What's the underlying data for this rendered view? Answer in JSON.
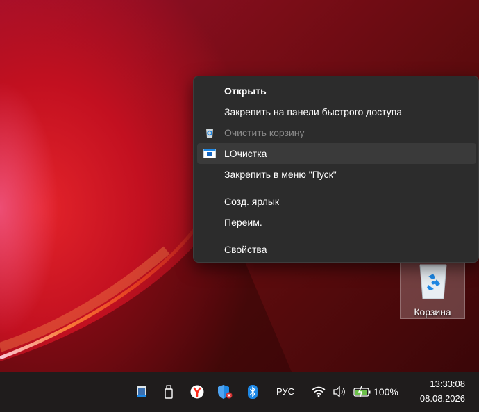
{
  "context_menu": {
    "items": [
      {
        "label": "Открыть",
        "bold": true
      },
      {
        "label": "Закрепить на панели быстрого доступа"
      },
      {
        "label": "Очистить корзину",
        "disabled": true,
        "icon": "recycle-bin-icon"
      },
      {
        "label": "LOчистка",
        "icon": "app-window-icon",
        "hovered": true
      },
      {
        "label": "Закрепить в меню \"Пуск\""
      },
      {
        "label": "Созд. ярлык"
      },
      {
        "label": "Переим."
      },
      {
        "label": "Свойства"
      }
    ]
  },
  "desktop": {
    "recycle_bin_label": "Корзина"
  },
  "taskbar": {
    "tray_icons": [
      "tablet-icon",
      "usb-drive-icon",
      "yandex-browser-icon",
      "defender-shield-icon",
      "bluetooth-icon",
      "wifi-icon",
      "volume-icon",
      "battery-charging-icon"
    ],
    "language": "РУС",
    "battery_percent": "100%",
    "time": "13:33:08",
    "date": "08.08.2026"
  },
  "colors": {
    "menu_background": "#2c2c2c",
    "menu_hover": "#3a3a3a",
    "taskbar": "#1f1c1c",
    "accent_blue": "#1e88e5"
  }
}
